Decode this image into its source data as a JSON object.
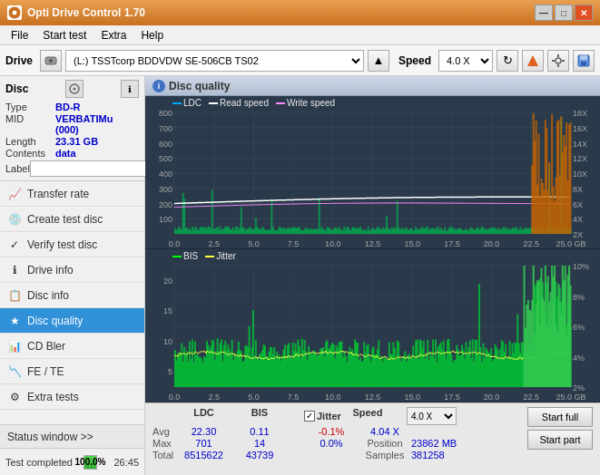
{
  "app": {
    "title": "Opti Drive Control 1.70",
    "icon": "disc"
  },
  "title_controls": {
    "minimize": "—",
    "maximize": "□",
    "close": "✕"
  },
  "menu": {
    "items": [
      "File",
      "Start test",
      "Extra",
      "Help"
    ]
  },
  "toolbar": {
    "drive_label": "Drive",
    "drive_value": "(L:)  TSSTcorp BDDVDW SE-506CB TS02",
    "speed_label": "Speed",
    "speed_value": "4.0 X"
  },
  "disc": {
    "title": "Disc",
    "type_label": "Type",
    "type_value": "BD-R",
    "mid_label": "MID",
    "mid_value": "VERBATIMu (000)",
    "length_label": "Length",
    "length_value": "23.31 GB",
    "contents_label": "Contents",
    "contents_value": "data",
    "label_label": "Label",
    "label_value": ""
  },
  "nav": {
    "items": [
      {
        "id": "transfer-rate",
        "label": "Transfer rate",
        "icon": "📈"
      },
      {
        "id": "create-test-disc",
        "label": "Create test disc",
        "icon": "💿"
      },
      {
        "id": "verify-test-disc",
        "label": "Verify test disc",
        "icon": "✓"
      },
      {
        "id": "drive-info",
        "label": "Drive info",
        "icon": "ℹ"
      },
      {
        "id": "disc-info",
        "label": "Disc info",
        "icon": "📋"
      },
      {
        "id": "disc-quality",
        "label": "Disc quality",
        "icon": "★",
        "active": true
      },
      {
        "id": "cd-bler",
        "label": "CD Bler",
        "icon": "📊"
      },
      {
        "id": "fe-te",
        "label": "FE / TE",
        "icon": "📉"
      },
      {
        "id": "extra-tests",
        "label": "Extra tests",
        "icon": "⚙"
      }
    ]
  },
  "status_window": {
    "label": "Status window >>"
  },
  "status_bar": {
    "text": "Test completed",
    "progress": 100,
    "progress_label": "100.0%",
    "time": "26:45"
  },
  "disc_quality": {
    "title": "Disc quality",
    "chart1": {
      "legend": [
        {
          "label": "LDC",
          "color": "#00aaff"
        },
        {
          "label": "Read speed",
          "color": "#ffffff"
        },
        {
          "label": "Write speed",
          "color": "#ff88ff"
        }
      ],
      "y_axis": [
        "800",
        "700",
        "600",
        "500",
        "400",
        "300",
        "200",
        "100"
      ],
      "y_axis_right": [
        "18X",
        "16X",
        "14X",
        "12X",
        "10X",
        "8X",
        "6X",
        "4X",
        "2X"
      ],
      "x_axis": [
        "0.0",
        "2.5",
        "5.0",
        "7.5",
        "10.0",
        "12.5",
        "15.0",
        "17.5",
        "20.0",
        "22.5",
        "25.0 GB"
      ]
    },
    "chart2": {
      "legend": [
        {
          "label": "BIS",
          "color": "#00ff00"
        },
        {
          "label": "Jitter",
          "color": "#ffff00"
        }
      ],
      "y_axis": [
        "20",
        "15",
        "10",
        "5"
      ],
      "y_axis_right": [
        "10%",
        "8%",
        "6%",
        "4%",
        "2%"
      ],
      "x_axis": [
        "0.0",
        "2.5",
        "5.0",
        "7.5",
        "10.0",
        "12.5",
        "15.0",
        "17.5",
        "20.0",
        "22.5",
        "25.0 GB"
      ]
    }
  },
  "stats": {
    "headers": [
      "LDC",
      "BIS",
      "",
      "Jitter",
      "Speed",
      ""
    ],
    "avg_label": "Avg",
    "avg_ldc": "22.30",
    "avg_bis": "0.11",
    "avg_jitter": "-0.1%",
    "max_label": "Max",
    "max_ldc": "701",
    "max_bis": "14",
    "max_jitter": "0.0%",
    "total_label": "Total",
    "total_ldc": "8515622",
    "total_bis": "43739",
    "jitter_checked": true,
    "jitter_label": "Jitter",
    "speed_label": "Speed",
    "speed_value": "4.04 X",
    "speed_select": "4.0 X",
    "position_label": "Position",
    "position_value": "23862 MB",
    "samples_label": "Samples",
    "samples_value": "381258",
    "start_full": "Start full",
    "start_part": "Start part"
  }
}
